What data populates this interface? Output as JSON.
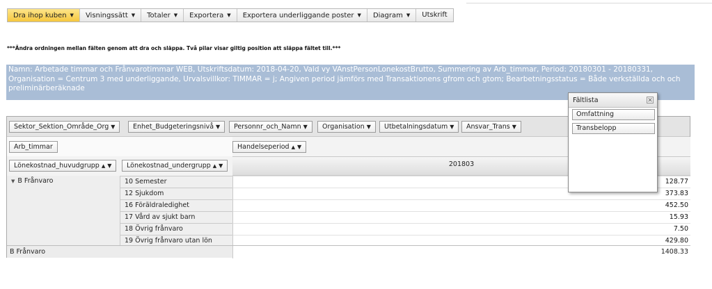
{
  "toolbar": {
    "items": [
      {
        "label": "Dra ihop kuben",
        "active": true,
        "dropdown": true
      },
      {
        "label": "Visningssätt",
        "dropdown": true
      },
      {
        "label": "Totaler",
        "dropdown": true
      },
      {
        "label": "Exportera",
        "dropdown": true
      },
      {
        "label": "Exportera underliggande poster",
        "dropdown": true
      },
      {
        "label": "Diagram",
        "dropdown": true
      },
      {
        "label": "Utskrift",
        "dropdown": false
      }
    ],
    "active_color": "#f6c73f"
  },
  "hint": "***Ändra ordningen mellan fälten genom att dra och släppa. Två pilar visar giltig position att släppa fältet till.***",
  "info_text": "Namn: Arbetade timmar och Frånvarotimmar WEB, Utskriftsdatum: 2018-04-20, Vald vy VAnstPersonLonekostBrutto, Summering av Arb_timmar, Period: 20180301 - 20180331, Organisation = Centrum 3 med underliggande, Urvalsvillkor: TIMMAR = j; Angiven period jämförs med Transaktionens gfrom och gtom; Bearbetningsstatus = Både verkställda och och preliminärberäknade",
  "filters": [
    "Sektor_Sektion_Område_Org",
    "Enhet_Budgeteringsnivå",
    "Personnr_och_Namn",
    "Organisation",
    "Utbetalningsdatum",
    "Ansvar_Trans"
  ],
  "data_field": "Arb_timmar",
  "column_field": "Handelseperiod",
  "row_fields": [
    "Lönekostnad_huvudgrupp",
    "Lönekostnad_undergrupp"
  ],
  "period": "201803",
  "group": {
    "label": "B Frånvaro"
  },
  "rows": [
    {
      "label": "10 Semester",
      "value": "128.77"
    },
    {
      "label": "12 Sjukdom",
      "value": "373.83"
    },
    {
      "label": "16 Föräldraledighet",
      "value": "452.50"
    },
    {
      "label": "17 Vård av sjukt barn",
      "value": "15.93"
    },
    {
      "label": "18 Övrig frånvaro",
      "value": "7.50"
    },
    {
      "label": "19 Övrig frånvaro utan lön",
      "value": "429.80"
    }
  ],
  "total": {
    "label": "B Frånvaro",
    "value": "1408.33"
  },
  "fieldlist": {
    "title": "Fältlista",
    "items": [
      "Omfattning",
      "Transbelopp"
    ]
  }
}
